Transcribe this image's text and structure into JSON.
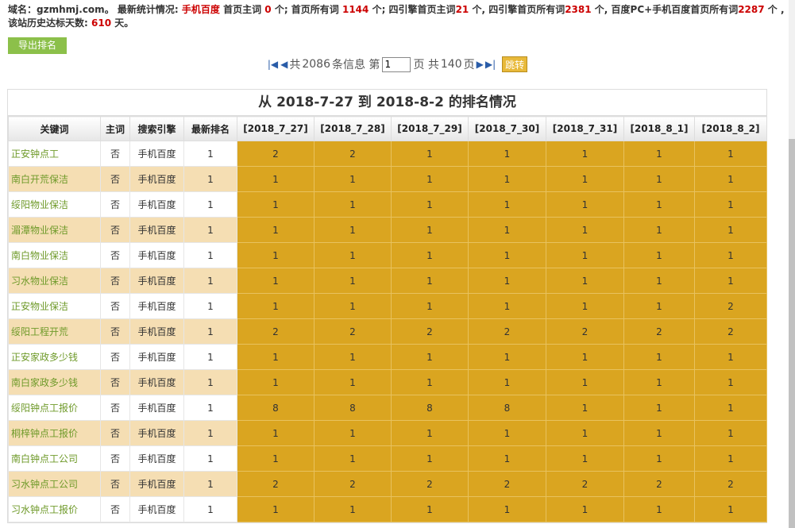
{
  "summary": {
    "domain_label": "域名：",
    "domain": "gzmhmj.com",
    "sep1": "。 最新统计情况:",
    "engine": "手机百度",
    "p1": "首页主词",
    "v1": "0",
    "p2": "个; 首页所有词",
    "v2": "1144",
    "p3": "个; 四引擎首页主词",
    "v3": "21",
    "p4": "个, 四引擎首页所有词",
    "v4": "2381",
    "p5": "个, 百度PC+手机百度首页所有词",
    "v5": "2287",
    "p6": "个 ,该站历史达标天数:",
    "v6": "610",
    "p7": "天。"
  },
  "toolbar": {
    "export_label": "导出排名"
  },
  "pager": {
    "first_icon": "first-page-icon",
    "prev_icon": "prev-page-icon",
    "next_icon": "next-page-icon",
    "last_icon": "last-page-icon",
    "total_prefix": "共",
    "total_count": "2086",
    "total_suffix": "条信息 第",
    "page_value": "1",
    "pages_prefix": "页 共",
    "pages_count": "140",
    "pages_suffix": "页",
    "jump_label": "跳转"
  },
  "table": {
    "title": "从 2018-7-27 到 2018-8-2 的排名情况",
    "headers": [
      "关键词",
      "主词",
      "搜索引擎",
      "最新排名",
      "[2018_7_27]",
      "[2018_7_28]",
      "[2018_7_29]",
      "[2018_7_30]",
      "[2018_7_31]",
      "[2018_8_1]",
      "[2018_8_2]"
    ],
    "rows": [
      {
        "keyword": "正安钟点工",
        "main": "否",
        "engine": "手机百度",
        "latest": "1",
        "ranks": [
          "2",
          "2",
          "1",
          "1",
          "1",
          "1",
          "1"
        ]
      },
      {
        "keyword": "南白开荒保洁",
        "main": "否",
        "engine": "手机百度",
        "latest": "1",
        "ranks": [
          "1",
          "1",
          "1",
          "1",
          "1",
          "1",
          "1"
        ]
      },
      {
        "keyword": "绥阳物业保洁",
        "main": "否",
        "engine": "手机百度",
        "latest": "1",
        "ranks": [
          "1",
          "1",
          "1",
          "1",
          "1",
          "1",
          "1"
        ]
      },
      {
        "keyword": "湄潭物业保洁",
        "main": "否",
        "engine": "手机百度",
        "latest": "1",
        "ranks": [
          "1",
          "1",
          "1",
          "1",
          "1",
          "1",
          "1"
        ]
      },
      {
        "keyword": "南白物业保洁",
        "main": "否",
        "engine": "手机百度",
        "latest": "1",
        "ranks": [
          "1",
          "1",
          "1",
          "1",
          "1",
          "1",
          "1"
        ]
      },
      {
        "keyword": "习水物业保洁",
        "main": "否",
        "engine": "手机百度",
        "latest": "1",
        "ranks": [
          "1",
          "1",
          "1",
          "1",
          "1",
          "1",
          "1"
        ]
      },
      {
        "keyword": "正安物业保洁",
        "main": "否",
        "engine": "手机百度",
        "latest": "1",
        "ranks": [
          "1",
          "1",
          "1",
          "1",
          "1",
          "1",
          "2"
        ]
      },
      {
        "keyword": "绥阳工程开荒",
        "main": "否",
        "engine": "手机百度",
        "latest": "1",
        "ranks": [
          "2",
          "2",
          "2",
          "2",
          "2",
          "2",
          "2"
        ]
      },
      {
        "keyword": "正安家政多少钱",
        "main": "否",
        "engine": "手机百度",
        "latest": "1",
        "ranks": [
          "1",
          "1",
          "1",
          "1",
          "1",
          "1",
          "1"
        ]
      },
      {
        "keyword": "南白家政多少钱",
        "main": "否",
        "engine": "手机百度",
        "latest": "1",
        "ranks": [
          "1",
          "1",
          "1",
          "1",
          "1",
          "1",
          "1"
        ]
      },
      {
        "keyword": "绥阳钟点工报价",
        "main": "否",
        "engine": "手机百度",
        "latest": "1",
        "ranks": [
          "8",
          "8",
          "8",
          "8",
          "1",
          "1",
          "1"
        ]
      },
      {
        "keyword": "桐梓钟点工报价",
        "main": "否",
        "engine": "手机百度",
        "latest": "1",
        "ranks": [
          "1",
          "1",
          "1",
          "1",
          "1",
          "1",
          "1"
        ]
      },
      {
        "keyword": "南白钟点工公司",
        "main": "否",
        "engine": "手机百度",
        "latest": "1",
        "ranks": [
          "1",
          "1",
          "1",
          "1",
          "1",
          "1",
          "1"
        ]
      },
      {
        "keyword": "习水钟点工公司",
        "main": "否",
        "engine": "手机百度",
        "latest": "1",
        "ranks": [
          "2",
          "2",
          "2",
          "2",
          "2",
          "2",
          "2"
        ]
      },
      {
        "keyword": "习水钟点工报价",
        "main": "否",
        "engine": "手机百度",
        "latest": "1",
        "ranks": [
          "1",
          "1",
          "1",
          "1",
          "1",
          "1",
          "1"
        ]
      }
    ]
  },
  "colors": {
    "rank_cell": "#daa520",
    "even_row": "#f5deb3",
    "keyword_text": "#6f9a2a",
    "highlight_red": "#cc0000",
    "export_button": "#8cc04a",
    "jump_button": "#e8b93a"
  }
}
